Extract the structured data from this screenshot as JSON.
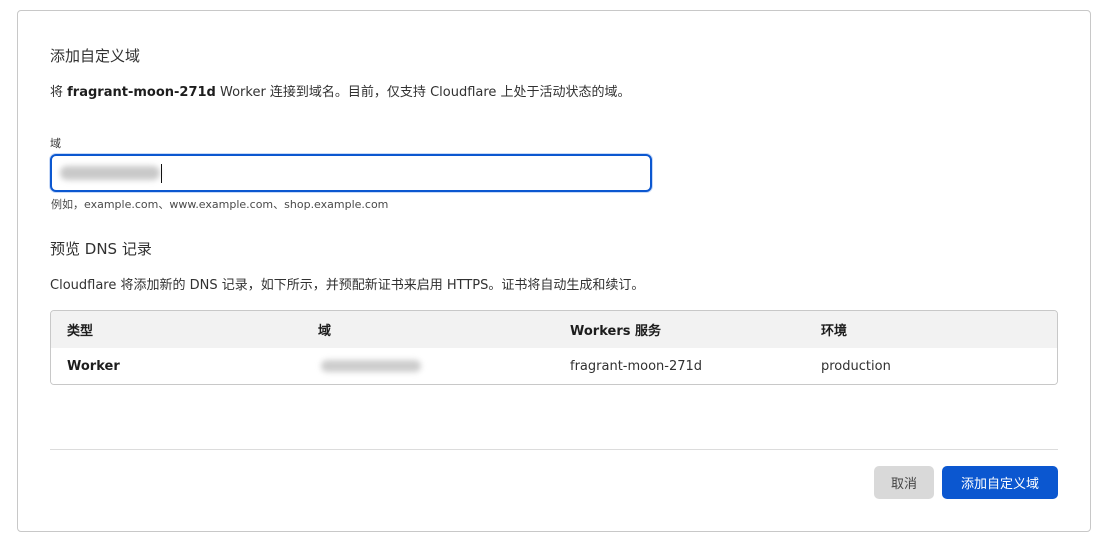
{
  "dialog": {
    "title": "添加自定义域",
    "description_prefix": "将",
    "worker_name": "fragrant-moon-271d",
    "description_suffix": "Worker 连接到域名。目前，仅支持 Cloudflare 上处于活动状态的域。"
  },
  "domain_field": {
    "label": "域",
    "hint": "例如，example.com、www.example.com、shop.example.com"
  },
  "preview": {
    "title": "预览 DNS 记录",
    "description": "Cloudflare 将添加新的 DNS 记录，如下所示，并预配新证书来启用 HTTPS。证书将自动生成和续订。",
    "columns": [
      "类型",
      "域",
      "Workers 服务",
      "环境"
    ],
    "rows": [
      {
        "type": "Worker",
        "domain": "",
        "service": "fragrant-moon-271d",
        "environment": "production"
      }
    ]
  },
  "actions": {
    "cancel_label": "取消",
    "submit_label": "添加自定义域"
  },
  "colors": {
    "accent": "#0b57d0",
    "cancel_bg": "#d9d9d9",
    "table_header_bg": "#f2f2f2"
  }
}
